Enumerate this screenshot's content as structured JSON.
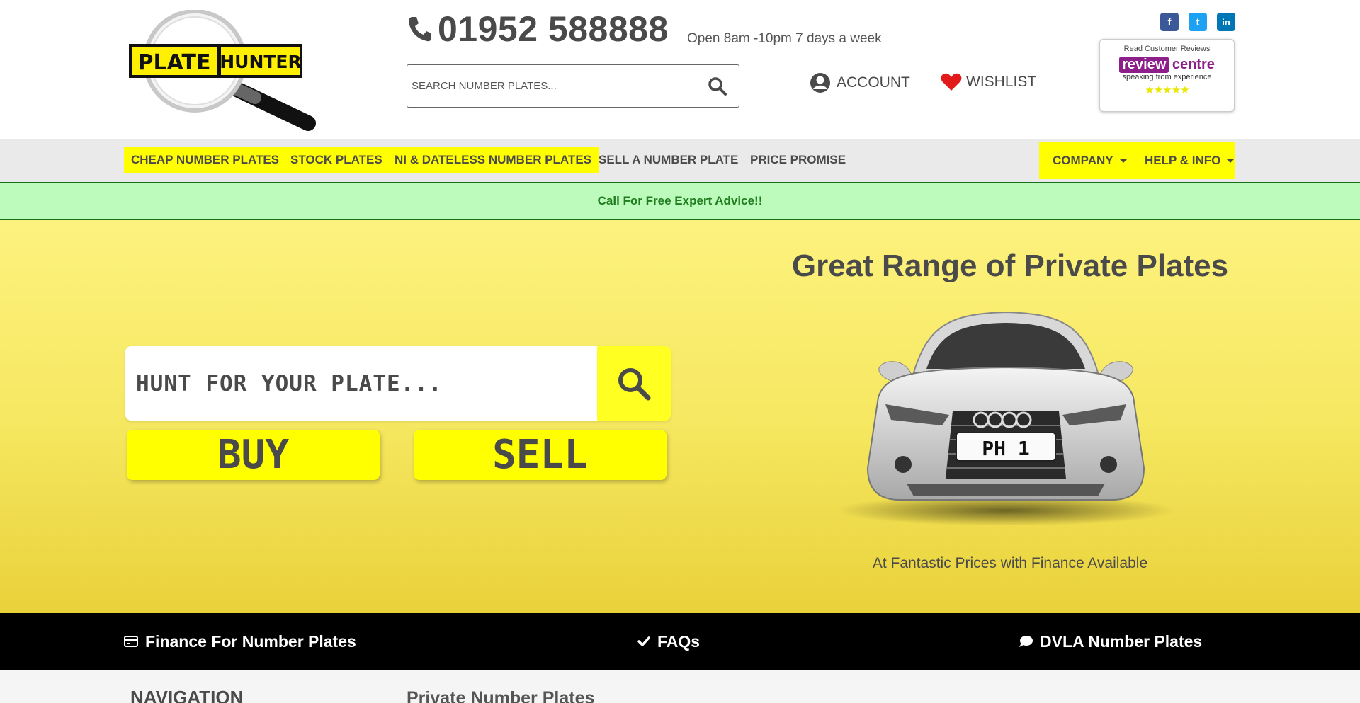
{
  "header": {
    "logo": {
      "word1": "PLATE",
      "word2": "HUNTER"
    },
    "phone": "01952 588888",
    "hours": "Open 8am -10pm 7 days a week",
    "search": {
      "placeholder": "SEARCH NUMBER PLATES..."
    },
    "account_label": "ACCOUNT",
    "wishlist_label": "WISHLIST",
    "socials": [
      {
        "name": "facebook",
        "glyph": "f",
        "color": "#3b5998"
      },
      {
        "name": "twitter",
        "glyph": "t",
        "color": "#1da1f2"
      },
      {
        "name": "linkedin",
        "glyph": "in",
        "color": "#0077b5"
      }
    ],
    "review": {
      "top": "Read Customer Reviews",
      "logo_part1": "review",
      "logo_part2": "centre",
      "tagline": "speaking from experience",
      "stars": "★★★★★"
    }
  },
  "nav": {
    "items": [
      {
        "label": "CHEAP NUMBER PLATES",
        "highlighted": true
      },
      {
        "label": "STOCK PLATES",
        "highlighted": true
      },
      {
        "label": "NI & DATELESS NUMBER PLATES",
        "highlighted": true
      },
      {
        "label": "SELL A NUMBER PLATE",
        "highlighted": false
      },
      {
        "label": "PRICE PROMISE",
        "highlighted": false
      }
    ],
    "dropdowns": [
      {
        "label": "COMPANY"
      },
      {
        "label": "HELP & INFO"
      }
    ]
  },
  "banner": {
    "advice": "Call For Free Expert Advice!!"
  },
  "hero": {
    "hunt_placeholder": "HUNT FOR YOUR PLATE...",
    "buy_label": "BUY",
    "sell_label": "SELL",
    "title": "Great Range of Private Plates",
    "car_plate": "PH 1",
    "subtitle": "At Fantastic Prices with Finance Available"
  },
  "feature_bar": {
    "items": [
      {
        "label": "Finance For Number Plates",
        "icon": "credit-card-icon"
      },
      {
        "label": "FAQs",
        "icon": "check-icon"
      },
      {
        "label": "DVLA Number Plates",
        "icon": "chat-bubble-icon"
      }
    ]
  },
  "bottom": {
    "nav_heading": "NAVIGATION",
    "section_heading": "Private Number Plates"
  },
  "colors": {
    "brand_yellow": "#ffff00",
    "text_dark": "#4a4a4a",
    "advice_bg": "#bdfbbd",
    "advice_text": "#1f7d1f",
    "wishlist_heart": "#e21a1a",
    "review_purple": "#8d1f8a"
  }
}
